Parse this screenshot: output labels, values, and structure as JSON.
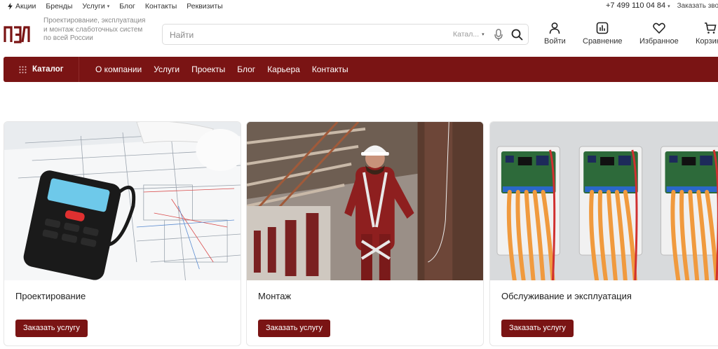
{
  "topbar": {
    "links": [
      {
        "label": "Акции"
      },
      {
        "label": "Бренды"
      },
      {
        "label": "Услуги"
      },
      {
        "label": "Блог"
      },
      {
        "label": "Контакты"
      },
      {
        "label": "Реквизиты"
      }
    ],
    "phone": "+7 499 110 04 84",
    "callback": "Заказать звонок"
  },
  "header": {
    "tagline": "Проектирование, эксплуатация и монтаж слаботочных систем по всей России",
    "search": {
      "placeholder": "Найти",
      "scope": "Катал..."
    },
    "actions": [
      {
        "label": "Войти",
        "icon": "user-icon"
      },
      {
        "label": "Сравнение",
        "icon": "compare-icon"
      },
      {
        "label": "Избранное",
        "icon": "heart-icon"
      },
      {
        "label": "Корзина",
        "icon": "cart-icon"
      }
    ]
  },
  "nav": {
    "catalog": "Каталог",
    "links": [
      "О компании",
      "Услуги",
      "Проекты",
      "Блог",
      "Карьера",
      "Контакты"
    ]
  },
  "services": [
    {
      "title": "Проектирование",
      "button": "Заказать услугу"
    },
    {
      "title": "Монтаж",
      "button": "Заказать услугу"
    },
    {
      "title": "Обслуживание и эксплуатация",
      "button": "Заказать услугу"
    }
  ],
  "colors": {
    "brand": "#7a1414",
    "text": "#222222",
    "muted": "#8a8a8a"
  }
}
